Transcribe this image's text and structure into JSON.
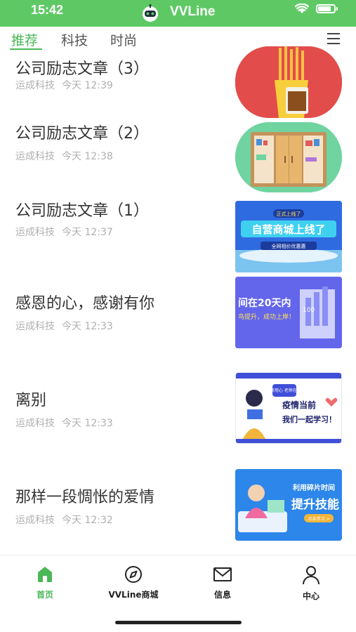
{
  "status_bar": {
    "time": "15:42"
  },
  "app": {
    "title": "VVLine"
  },
  "tabs": [
    {
      "label": "推荐",
      "active": true
    },
    {
      "label": "科技",
      "active": false
    },
    {
      "label": "时尚",
      "active": false
    }
  ],
  "articles": [
    {
      "title": "公司励志文章（3）",
      "source": "运成科技",
      "time": "今天 12:39",
      "thumb_icon": "fries-illustration"
    },
    {
      "title": "公司励志文章（2）",
      "source": "运成科技",
      "time": "今天 12:38",
      "thumb_icon": "cabinet-illustration"
    },
    {
      "title": "公司励志文章（1）",
      "source": "运成科技",
      "time": "今天 12:37",
      "thumb_text": [
        "正式上线了",
        "自营商城上线了",
        "全网相价优惠惠"
      ]
    },
    {
      "title": "感恩的心，感谢有你",
      "source": "运成科技",
      "time": "今天 12:33",
      "thumb_text": [
        "间在20天内",
        "鸟提升，成功上岸！",
        "100"
      ]
    },
    {
      "title": "离别",
      "source": "运成科技",
      "time": "今天 12:33",
      "thumb_text": [
        "新用心 老师在!",
        "疫情当前",
        "我们一起学习！"
      ]
    },
    {
      "title": "那样一段惆怅的爱情",
      "source": "运成科技",
      "time": "今天 12:32",
      "thumb_text": [
        "利用碎片时间",
        "提升技能",
        "点击学习 >"
      ]
    }
  ],
  "bottom_nav": [
    {
      "label": "首页",
      "icon": "home-icon",
      "active": true
    },
    {
      "label": "VVLine商城",
      "icon": "compass-icon",
      "active": false
    },
    {
      "label": "信息",
      "icon": "mail-icon",
      "active": false
    },
    {
      "label": "中心",
      "icon": "person-icon",
      "active": false
    }
  ],
  "colors": {
    "brand": "#5ec964",
    "active": "#4ab857",
    "meta": "#b0b0b0"
  }
}
